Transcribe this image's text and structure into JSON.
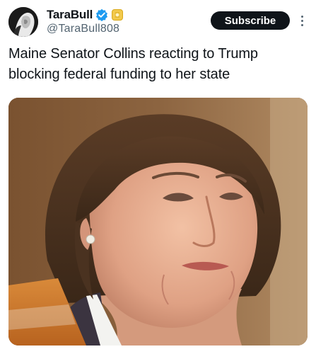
{
  "author": {
    "display_name": "TaraBull",
    "handle": "@TaraBull808",
    "verified_icon": "verified-badge-icon",
    "affiliate_icon": "affiliate-badge-icon"
  },
  "actions": {
    "subscribe_label": "Subscribe",
    "more_icon": "more-vertical-icon"
  },
  "tweet": {
    "text": "Maine Senator Collins reacting to Trump blocking federal funding to her state"
  },
  "media": {
    "type": "photo"
  },
  "colors": {
    "text": "#0f1419",
    "secondary": "#536471",
    "verified": "#1d9bf0",
    "affiliate": "#e2b719",
    "button": "#0f1419"
  }
}
